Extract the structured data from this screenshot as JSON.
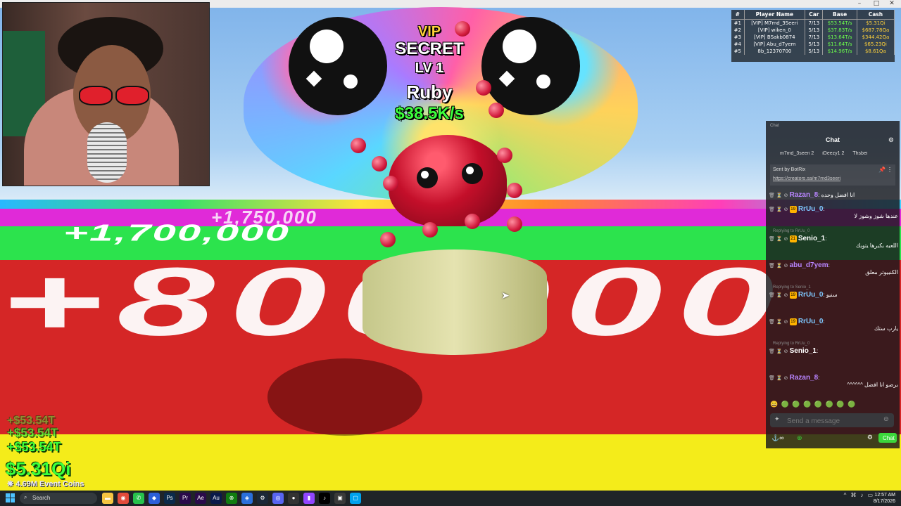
{
  "game": {
    "pet": {
      "tier": "VIP",
      "rarity": "SECRET",
      "level": "LV 1",
      "name": "Ruby",
      "rate": "$38.5K/s"
    },
    "floor_numbers": [
      "+1,750,000",
      "+1,700,000",
      "+800000"
    ]
  },
  "leaderboard": {
    "headers": [
      "#",
      "Player Name",
      "Car",
      "Base",
      "Cash"
    ],
    "rows": [
      [
        "#1",
        "[VIP] M7md_3Seeri",
        "7/13",
        "$53.54T/s",
        "$5.31Qi"
      ],
      [
        "#2",
        "[VIP] wiken_0",
        "5/13",
        "$37.83T/s",
        "$687.78Qa"
      ],
      [
        "#3",
        "[VIP] BSakb0874",
        "7/13",
        "$13.64T/s",
        "$344.42Qa"
      ],
      [
        "#4",
        "[VIP] Abu_d7yem",
        "5/13",
        "$11.64T/s",
        "$65.23Qi"
      ],
      [
        "#5",
        "8b_12370700",
        "5/13",
        "$14.96T/s",
        "$8.61Qa"
      ]
    ]
  },
  "chat": {
    "header_small": "Chat",
    "title": "Chat",
    "top_users": [
      "m7md_3seeri 2",
      "iDeezy1 2",
      "Thsbei"
    ],
    "pinned": {
      "sent_by": "Sent by BotRix",
      "link": "https://creators.sa/m7md3seeri"
    },
    "messages": [
      {
        "user": "Razan_8",
        "badge": "",
        "text": "انا افضل وحده",
        "color": "#b985ff"
      },
      {
        "user": "RrUu_0",
        "badge": "19",
        "text": "عندها شوز وشوز لا",
        "color": "#7ec8ff"
      },
      {
        "user": "Senio_1",
        "badge": "21",
        "text": "اللعبه بكبرها يتوبك",
        "color": "#ffffff"
      },
      {
        "user": "abu_d7yem",
        "badge": "",
        "text": "الكنبيوتر معلق",
        "color": "#b985ff"
      },
      {
        "user": "RrUu_0",
        "badge": "19",
        "text": "سنيو",
        "color": "#7ec8ff"
      },
      {
        "user": "RrUu_0",
        "badge": "19",
        "text": "يارب ستك",
        "color": "#7ec8ff"
      },
      {
        "user": "Senio_1",
        "badge": "",
        "text": "",
        "color": "#ffffff"
      },
      {
        "user": "Razan_8",
        "badge": "",
        "text": "برضو انا افضل ^^^^^^",
        "color": "#b985ff"
      }
    ],
    "reply_hints": [
      "Replying to RrUu_0",
      "Replying to Senio_1",
      "Replying to RrUu_0"
    ],
    "input_placeholder": "Send a message",
    "send_label": "Chat"
  },
  "hud": {
    "gains": [
      "+$53.54T",
      "+$53.54T",
      "+$53.54T"
    ],
    "cash": "$5.31Qi",
    "event_coins": "4.69M Event Coins"
  },
  "taskbar": {
    "search_label": "Search",
    "time": "12:57 AM",
    "date": "8/17/2026"
  },
  "colors": {
    "accent_green": "#3cff3c",
    "gold": "#ffd23a",
    "chat_send": "#3bd63b"
  }
}
